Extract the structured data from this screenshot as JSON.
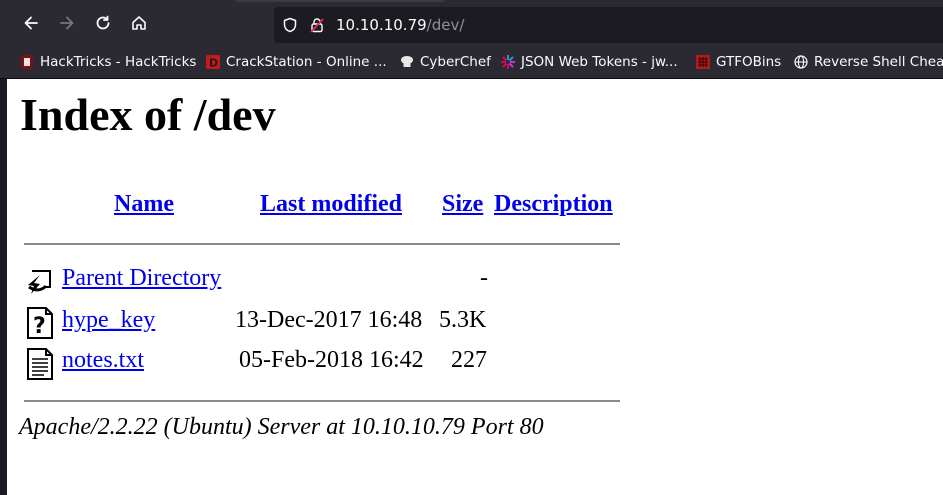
{
  "browser": {
    "url_host": "10.10.10.79",
    "url_path": "/dev/"
  },
  "bookmarks": [
    {
      "label": "HackTricks - HackTricks",
      "icon": "hacktricks-icon"
    },
    {
      "label": "CrackStation - Online ...",
      "icon": "crackstation-icon"
    },
    {
      "label": "CyberChef",
      "icon": "cyberchef-icon"
    },
    {
      "label": "JSON Web Tokens - jw...",
      "icon": "jwt-icon"
    },
    {
      "label": "GTFOBins",
      "icon": "gtfobins-icon"
    },
    {
      "label": "Reverse Shell Cheat",
      "icon": "globe-icon"
    }
  ],
  "page": {
    "title": "Index of /dev",
    "columns": {
      "name": "Name",
      "last_modified": "Last modified",
      "size": "Size",
      "description": "Description"
    },
    "rows": [
      {
        "name": "Parent Directory",
        "modified": "",
        "size": "-",
        "icon": "back-folder-icon"
      },
      {
        "name": "hype_key",
        "modified": "13-Dec-2017 16:48",
        "size": "5.3K",
        "icon": "unknown-file-icon"
      },
      {
        "name": "notes.txt",
        "modified": "05-Feb-2018 16:42",
        "size": "227",
        "icon": "text-file-icon"
      }
    ],
    "footer": "Apache/2.2.22 (Ubuntu) Server at 10.10.10.79 Port 80"
  }
}
